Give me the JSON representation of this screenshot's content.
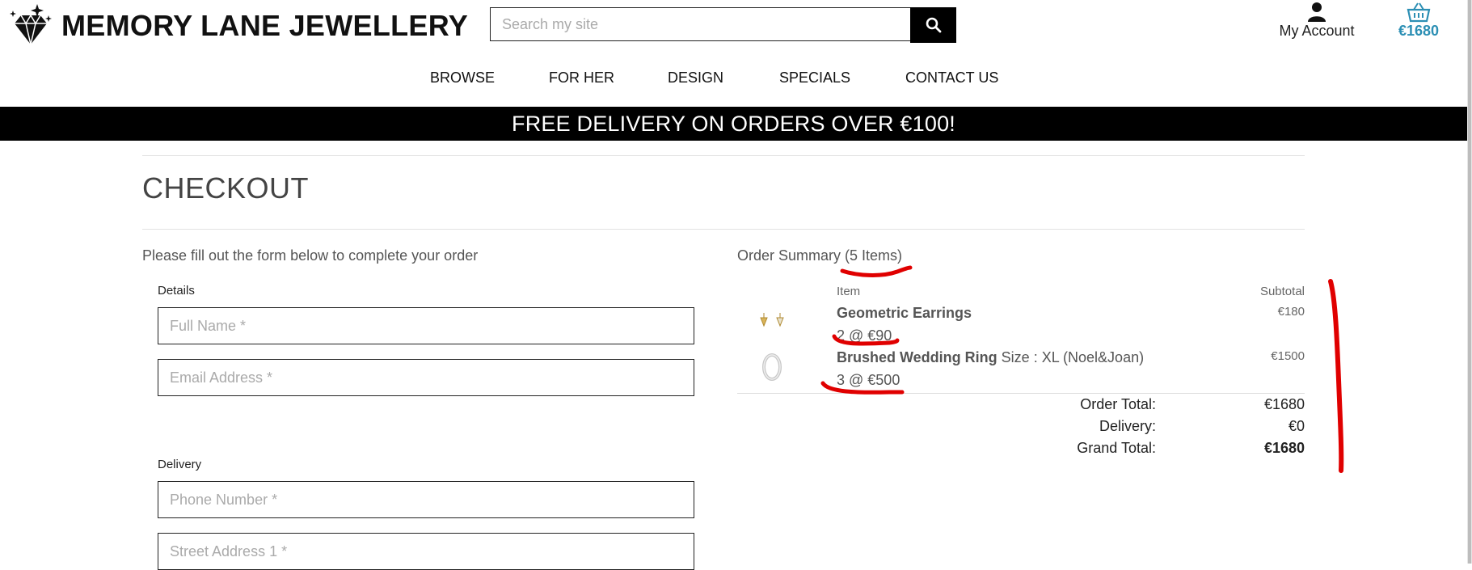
{
  "brand": {
    "name": "MEMORY LANE JEWELLERY"
  },
  "search": {
    "placeholder": "Search my site"
  },
  "account": {
    "label": "My Account"
  },
  "basket": {
    "total": "€1680"
  },
  "nav": {
    "items": [
      "BROWSE",
      "FOR HER",
      "DESIGN",
      "SPECIALS",
      "CONTACT US"
    ]
  },
  "banner": {
    "text": "FREE DELIVERY ON ORDERS OVER €100!"
  },
  "checkout": {
    "title": "CHECKOUT",
    "intro": "Please fill out the form below to complete your order",
    "details_label": "Details",
    "delivery_label": "Delivery",
    "fields": {
      "full_name": "Full Name *",
      "email": "Email Address *",
      "phone": "Phone Number *",
      "street1": "Street Address 1 *"
    }
  },
  "summary": {
    "title": "Order Summary (5 Items)",
    "col_item": "Item",
    "col_subtotal": "Subtotal",
    "items": [
      {
        "name": "Geometric Earrings",
        "meta": "",
        "qty": "2 @ €90",
        "subtotal": "€180"
      },
      {
        "name": "Brushed Wedding Ring",
        "meta": " Size : XL (Noel&Joan)",
        "qty": "3 @ €500",
        "subtotal": "€1500"
      }
    ],
    "totals": {
      "order_total_label": "Order Total:",
      "order_total": "€1680",
      "delivery_label": "Delivery:",
      "delivery": "€0",
      "grand_total_label": "Grand Total:",
      "grand_total": "€1680"
    }
  },
  "colors": {
    "accent": "#2c8fb4",
    "banner_bg": "#000000",
    "annotation": "#e00000"
  }
}
